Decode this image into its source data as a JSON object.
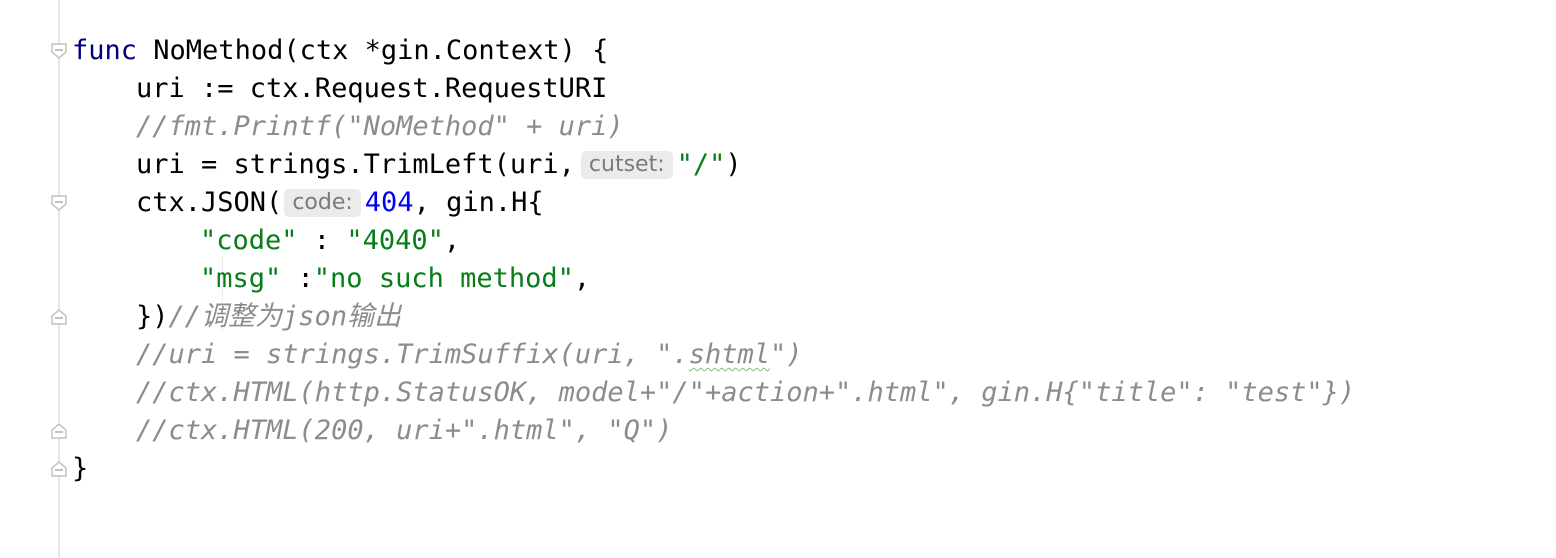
{
  "editor": {
    "lines": [
      {
        "parts": [
          "func",
          " NoMethod(ctx *gin.Context) {"
        ]
      },
      {
        "parts": [
          "uri := ctx.Request.RequestURI"
        ]
      },
      {
        "parts": [
          "//fmt.Printf(\"NoMethod\" + uri)"
        ]
      },
      {
        "parts": [
          "uri = strings.TrimLeft(uri,",
          "cutset:",
          "\"/\"",
          ")"
        ]
      },
      {
        "parts": [
          "ctx.JSON(",
          "code:",
          "404",
          ", gin.H{"
        ]
      },
      {
        "parts": [
          "\"code\"",
          " : ",
          "\"4040\"",
          ","
        ]
      },
      {
        "parts": [
          "\"msg\"",
          " :",
          "\"no such method\"",
          ","
        ]
      },
      {
        "parts": [
          "})",
          "//调整为json输出"
        ]
      },
      {
        "parts": [
          "//uri = strings.TrimSuffix(uri, \".",
          "shtml",
          "\")"
        ]
      },
      {
        "parts": [
          "//ctx.HTML(http.StatusOK, model+\"/\"+action+\".html\", gin.H{\"title\": \"test\"})"
        ]
      },
      {
        "parts": [
          "//ctx.HTML(200, uri+\".html\", \"Q\")"
        ]
      },
      {
        "parts": [
          "}"
        ]
      }
    ]
  },
  "colors": {
    "keyword": "#000080",
    "number": "#0000ff",
    "string": "#067d17",
    "comment": "#8c8c8c",
    "hint_bg": "#ebebeb"
  }
}
